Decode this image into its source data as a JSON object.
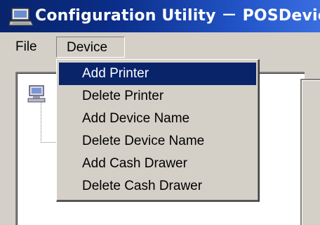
{
  "window": {
    "title": "Configuration Utility －  POSDevic",
    "icon": "computer-icon"
  },
  "menubar": {
    "items": [
      {
        "label": "File"
      },
      {
        "label": "Device",
        "open": true
      }
    ]
  },
  "device_menu": {
    "items": [
      {
        "label": "Add Printer",
        "highlighted": true
      },
      {
        "label": "Delete Printer"
      },
      {
        "label": "Add Device Name"
      },
      {
        "label": "Delete Device Name"
      },
      {
        "label": "Add Cash Drawer"
      },
      {
        "label": "Delete Cash Drawer"
      }
    ]
  },
  "tree": {
    "root_icon": "computer-icon"
  },
  "colors": {
    "titlebar_start": "#08246b",
    "titlebar_end": "#3a6ee0",
    "selection": "#0a246a",
    "face": "#d4d0c8"
  }
}
